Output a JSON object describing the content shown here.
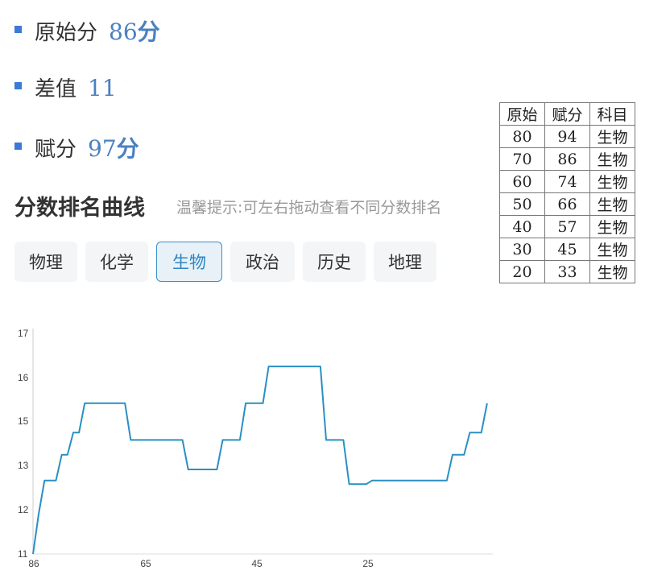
{
  "stats": [
    {
      "label": "原始分",
      "value": "86",
      "unit": "分"
    },
    {
      "label": "差值",
      "value": "11",
      "unit": ""
    },
    {
      "label": "赋分",
      "value": "97",
      "unit": "分"
    }
  ],
  "section": {
    "title": "分数排名曲线",
    "hint": "温馨提示:可左右拖动查看不同分数排名"
  },
  "tabs": [
    {
      "label": "物理",
      "selected": false
    },
    {
      "label": "化学",
      "selected": false
    },
    {
      "label": "生物",
      "selected": true
    },
    {
      "label": "政治",
      "selected": false
    },
    {
      "label": "历史",
      "selected": false
    },
    {
      "label": "地理",
      "selected": false
    }
  ],
  "table": {
    "headers": [
      "原始",
      "赋分",
      "科目"
    ],
    "rows": [
      [
        "80",
        "94",
        "生物"
      ],
      [
        "70",
        "86",
        "生物"
      ],
      [
        "60",
        "74",
        "生物"
      ],
      [
        "50",
        "66",
        "生物"
      ],
      [
        "40",
        "57",
        "生物"
      ],
      [
        "30",
        "45",
        "生物"
      ],
      [
        "20",
        "33",
        "生物"
      ]
    ]
  },
  "colors": {
    "accent": "#3a7bd5",
    "line": "#2a8fc4",
    "value_text": "#4a80c2"
  },
  "chart_data": {
    "type": "line",
    "title": "",
    "xlabel": "",
    "ylabel": "",
    "x_ticks": [
      "86",
      "65",
      "45",
      "25"
    ],
    "y_ticks": [
      "11",
      "12",
      "13",
      "15",
      "16",
      "17"
    ],
    "x_range": [
      86,
      6
    ],
    "y_range": [
      11,
      17
    ],
    "series": [
      {
        "values": [
          [
            86,
            11
          ],
          [
            85,
            12.1
          ],
          [
            84,
            13
          ],
          [
            82,
            13
          ],
          [
            81,
            13.7
          ],
          [
            80,
            13.7
          ],
          [
            79,
            14.3
          ],
          [
            78,
            14.3
          ],
          [
            77,
            15.1
          ],
          [
            70,
            15.1
          ],
          [
            69,
            14.1
          ],
          [
            60,
            14.1
          ],
          [
            59,
            13.3
          ],
          [
            54,
            13.3
          ],
          [
            53,
            14.1
          ],
          [
            50,
            14.1
          ],
          [
            49,
            15.1
          ],
          [
            46,
            15.1
          ],
          [
            45,
            16.1
          ],
          [
            36,
            16.1
          ],
          [
            35,
            14.1
          ],
          [
            32,
            14.1
          ],
          [
            31,
            12.9
          ],
          [
            28,
            12.9
          ],
          [
            27,
            13
          ],
          [
            14,
            13
          ],
          [
            13,
            13.7
          ],
          [
            11,
            13.7
          ],
          [
            10,
            14.3
          ],
          [
            8,
            14.3
          ],
          [
            7,
            15.1
          ]
        ]
      }
    ]
  }
}
